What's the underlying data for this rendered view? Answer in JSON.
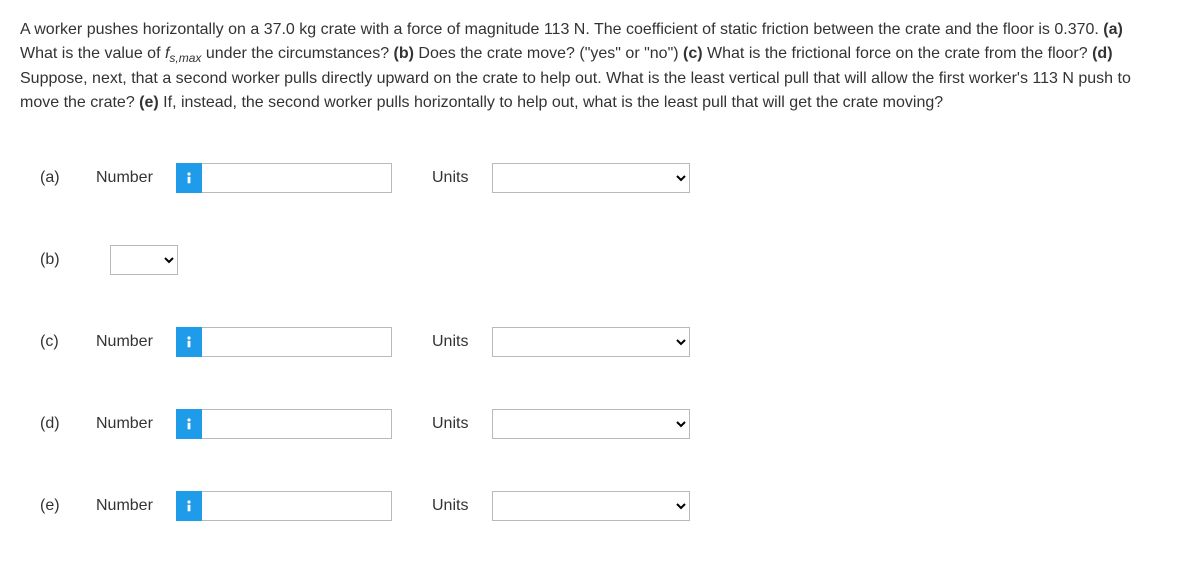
{
  "question": {
    "p1a": "A worker pushes horizontally on a 37.0 kg crate with a force of magnitude 113 N. The coefficient of static friction between the crate and the floor is 0.370. ",
    "a_bold": "(a)",
    "a_txt": " What is the value of ",
    "fsymbol": "f",
    "sub": "s,max",
    "a_txt2": " under the circumstances? ",
    "b_bold": "(b)",
    "b_txt": " Does the crate move? (\"yes\" or \"no\") ",
    "c_bold": "(c)",
    "c_txt": " What is the frictional force on the crate from the floor? ",
    "d_bold": "(d)",
    "d_txt": " Suppose, next, that a second worker pulls directly upward on the crate to help out. What is the least vertical pull that will allow the first worker's 113 N push to move the crate? ",
    "e_bold": "(e)",
    "e_txt": " If, instead, the second worker pulls horizontally to help out, what is the least pull that will get the crate moving?"
  },
  "rows": {
    "a": {
      "part": "(a)",
      "numLabel": "Number",
      "unitsLabel": "Units"
    },
    "b": {
      "part": "(b)"
    },
    "c": {
      "part": "(c)",
      "numLabel": "Number",
      "unitsLabel": "Units"
    },
    "d": {
      "part": "(d)",
      "numLabel": "Number",
      "unitsLabel": "Units"
    },
    "e": {
      "part": "(e)",
      "numLabel": "Number",
      "unitsLabel": "Units"
    }
  }
}
